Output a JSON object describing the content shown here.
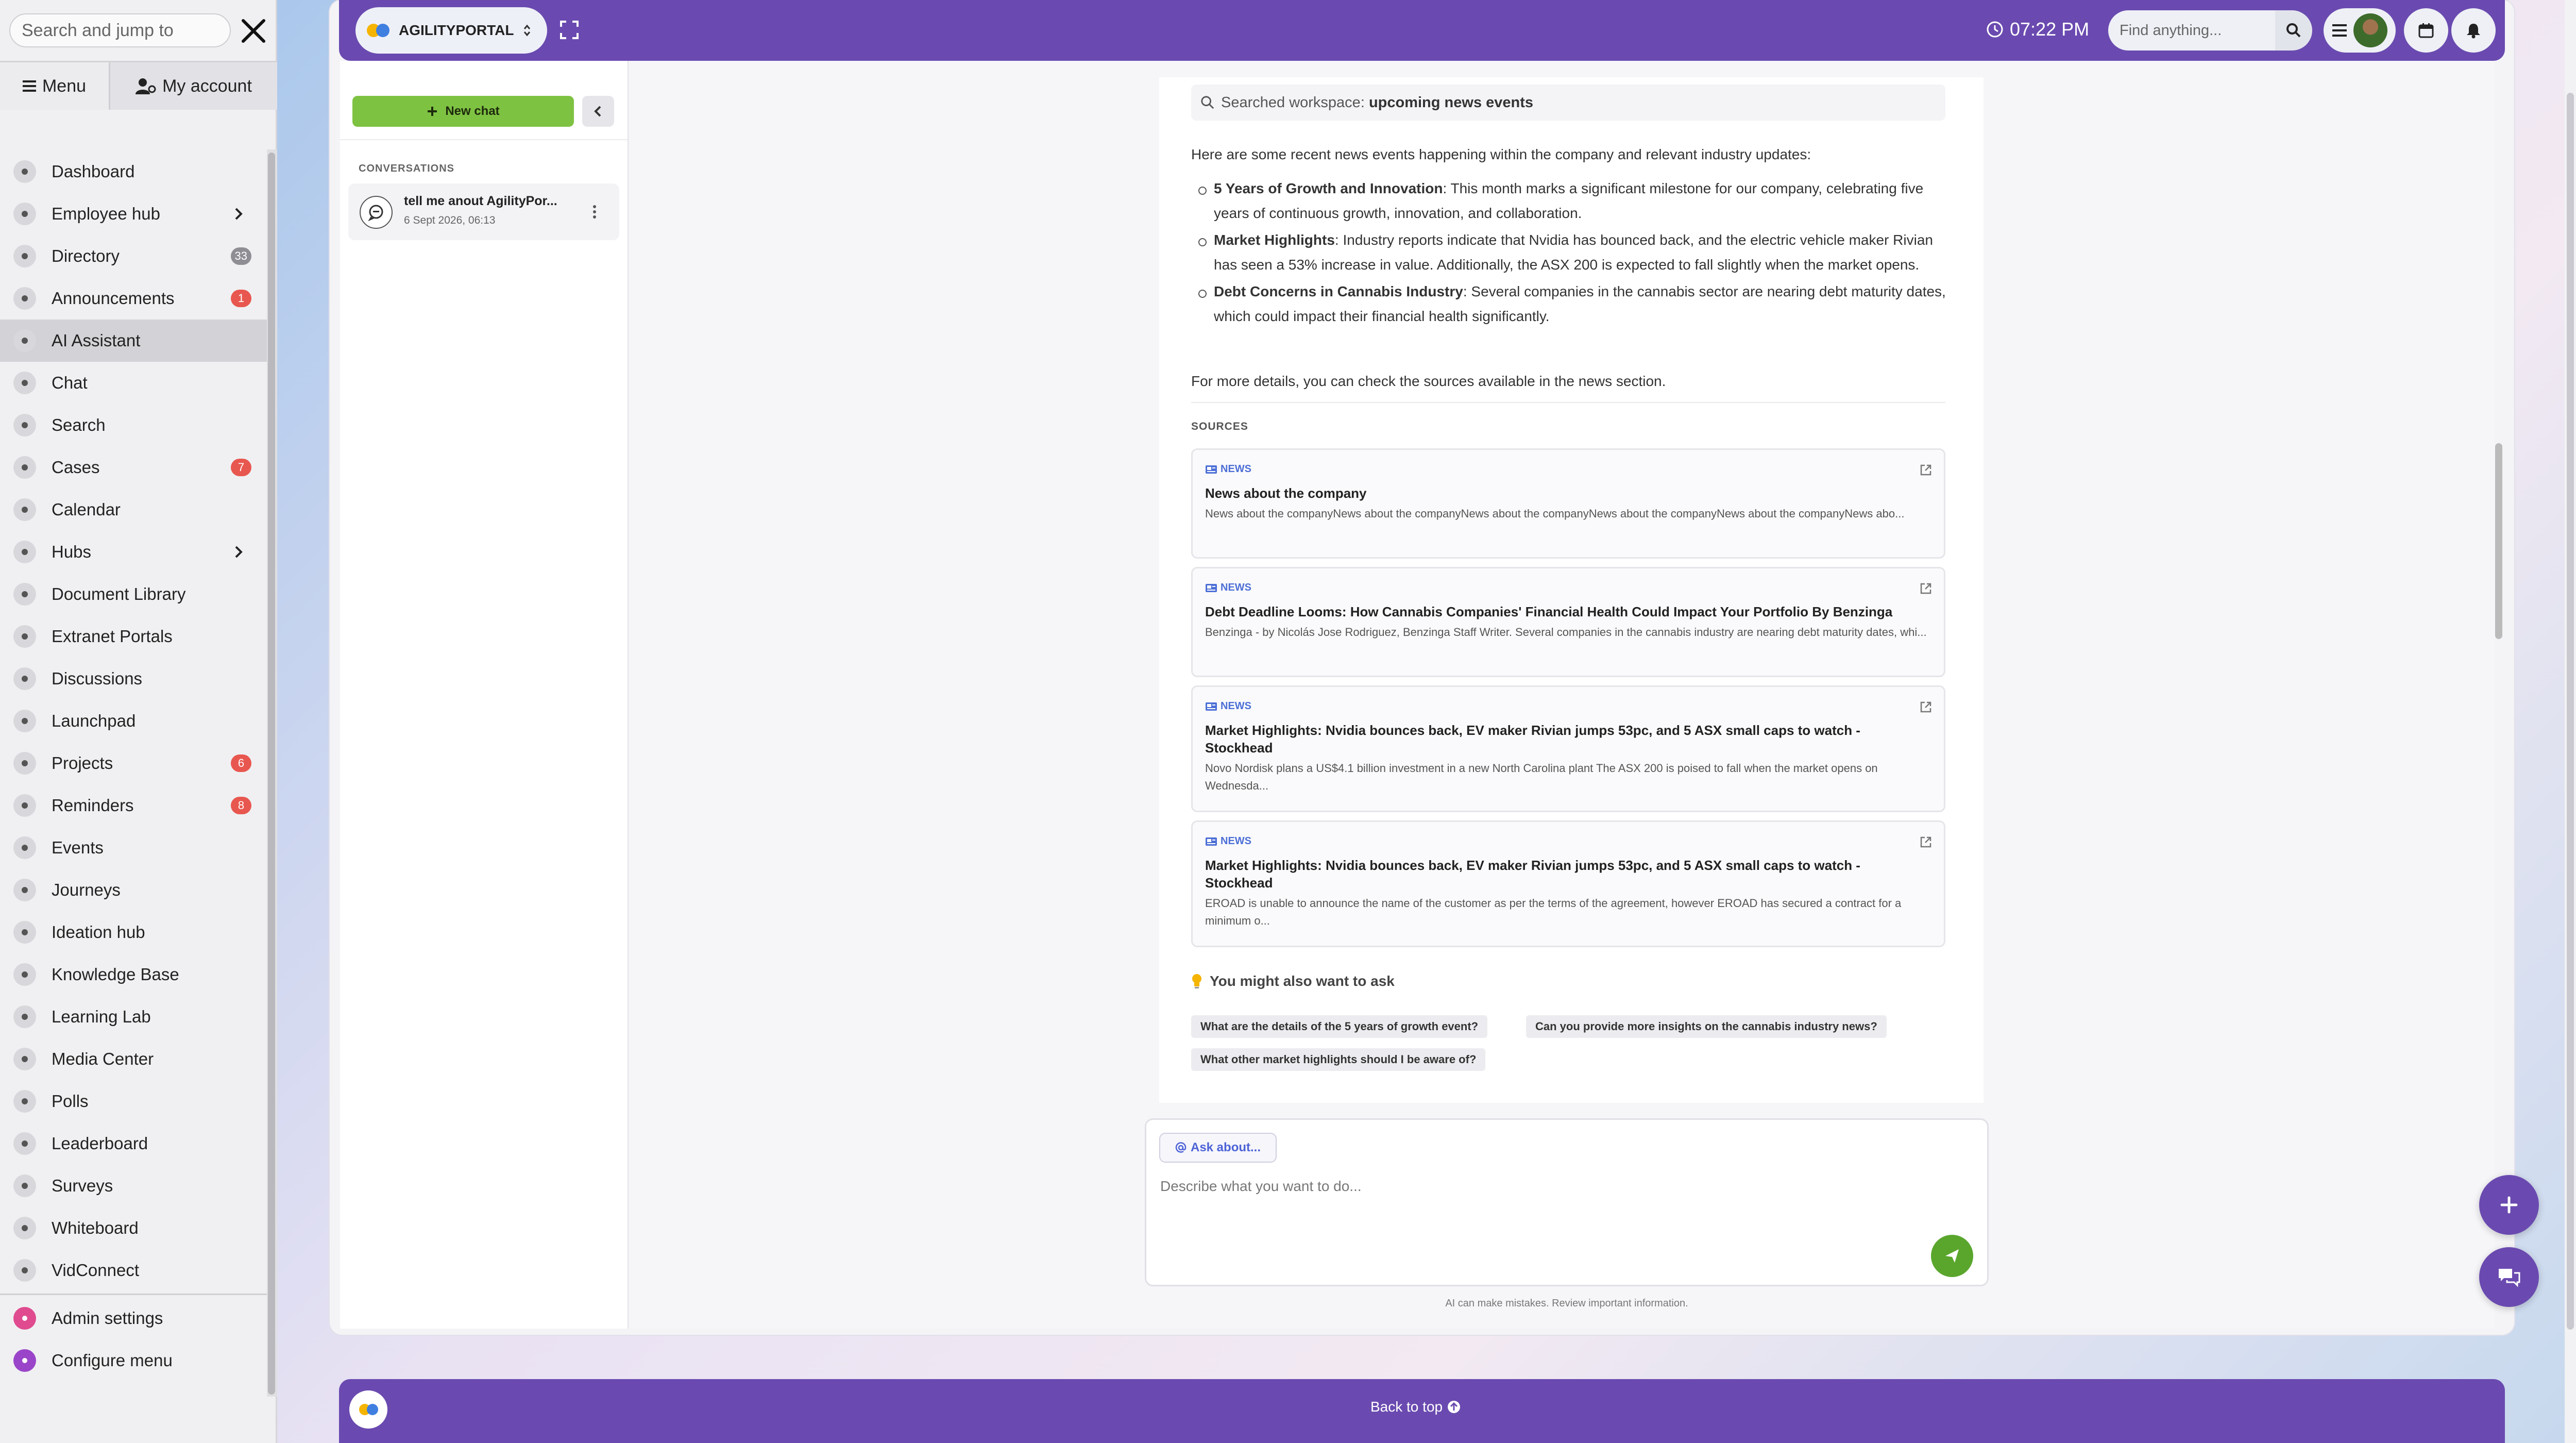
{
  "left_nav": {
    "search_placeholder": "Search and jump to",
    "tabs": {
      "menu": "Menu",
      "account": "My account"
    },
    "items": [
      {
        "label": "Dashboard"
      },
      {
        "label": "Employee hub",
        "chevron": true
      },
      {
        "label": "Directory",
        "badge": "33",
        "badge_style": "gray"
      },
      {
        "label": "Announcements",
        "badge": "1",
        "badge_style": "red"
      },
      {
        "label": "AI Assistant",
        "active": true
      },
      {
        "label": "Chat"
      },
      {
        "label": "Search"
      },
      {
        "label": "Cases",
        "badge": "7",
        "badge_style": "red"
      },
      {
        "label": "Calendar"
      },
      {
        "label": "Hubs",
        "chevron": true
      },
      {
        "label": "Document Library"
      },
      {
        "label": "Extranet Portals"
      },
      {
        "label": "Discussions"
      },
      {
        "label": "Launchpad"
      },
      {
        "label": "Projects",
        "badge": "6",
        "badge_style": "red"
      },
      {
        "label": "Reminders",
        "badge": "8",
        "badge_style": "red"
      },
      {
        "label": "Events"
      },
      {
        "label": "Journeys"
      },
      {
        "label": "Ideation hub"
      },
      {
        "label": "Knowledge Base"
      },
      {
        "label": "Learning Lab"
      },
      {
        "label": "Media Center"
      },
      {
        "label": "Polls"
      },
      {
        "label": "Leaderboard"
      },
      {
        "label": "Surveys"
      },
      {
        "label": "Whiteboard"
      },
      {
        "label": "VidConnect"
      }
    ],
    "admin_items": [
      {
        "label": "Admin settings"
      },
      {
        "label": "Configure menu"
      }
    ]
  },
  "topbar": {
    "portal_name": "AGILITYPORTAL",
    "time": "07:22 PM",
    "find_placeholder": "Find anything...",
    "accent": "#6a4ab0"
  },
  "chat_sidebar": {
    "new_chat": "New chat",
    "conversations_heading": "CONVERSATIONS",
    "conversation": {
      "title": "tell me anout AgilityPor...",
      "date": "6 Sept 2026, 06:13"
    }
  },
  "message": {
    "searched_prefix": "Searched workspace:",
    "searched_query": "upcoming news events",
    "intro": "Here are some recent news events happening within the company and relevant industry updates:",
    "bullets": [
      {
        "title": "5 Years of Growth and Innovation",
        "text": ": This month marks a significant milestone for our company, celebrating five years of continuous growth, innovation, and collaboration."
      },
      {
        "title": "Market Highlights",
        "text": ": Industry reports indicate that Nvidia has bounced back, and the electric vehicle maker Rivian has seen a 53% increase in value. Additionally, the ASX 200 is expected to fall slightly when the market opens."
      },
      {
        "title": "Debt Concerns in Cannabis Industry",
        "text": ": Several companies in the cannabis sector are nearing debt maturity dates, which could impact their financial health significantly."
      }
    ],
    "outro": "For more details, you can check the sources available in the news section.",
    "sources_heading": "SOURCES",
    "sources": [
      {
        "badge": "NEWS",
        "title": "News about the company",
        "snippet": "News about the companyNews about the companyNews about the companyNews about the companyNews about the companyNews abo..."
      },
      {
        "badge": "NEWS",
        "title": "Debt Deadline Looms: How Cannabis Companies' Financial Health Could Impact Your Portfolio By Benzinga",
        "snippet": "Benzinga - by Nicolás Jose Rodriguez, Benzinga Staff Writer. Several companies in the cannabis industry are nearing debt maturity dates, whi..."
      },
      {
        "badge": "NEWS",
        "title": "Market Highlights: Nvidia bounces back, EV maker Rivian jumps 53pc, and 5 ASX small caps to watch - Stockhead",
        "snippet": "Novo Nordisk plans a US$4.1 billion investment in a new North Carolina plant The ASX 200 is poised to fall when the market opens on Wednesda..."
      },
      {
        "badge": "NEWS",
        "title": "Market Highlights: Nvidia bounces back, EV maker Rivian jumps 53pc, and 5 ASX small caps to watch - Stockhead",
        "snippet": "EROAD is unable to announce the name of the customer as per the terms of the agreement, however EROAD has secured a contract for a minimum o..."
      }
    ],
    "suggest_heading": "You might also want to ask",
    "suggestions": [
      "What are the details of the 5 years of growth event?",
      "Can you provide more insights on the cannabis industry news?",
      "What other market highlights should I be aware of?"
    ]
  },
  "composer": {
    "ask_about": "Ask about...",
    "placeholder": "Describe what you want to do...",
    "disclaimer": "AI can make mistakes. Review important information."
  },
  "footer": {
    "back_to_top": "Back to top"
  }
}
